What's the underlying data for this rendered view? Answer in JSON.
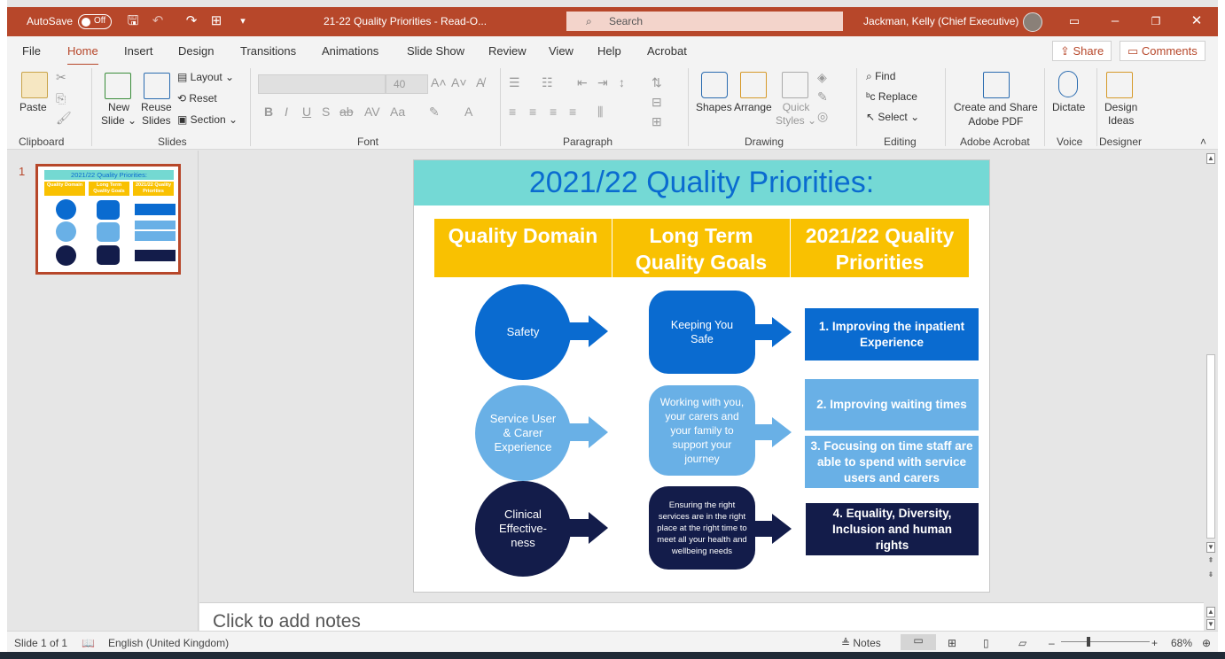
{
  "titlebar": {
    "autosave_label": "AutoSave",
    "autosave_state": "Off",
    "document_title": "21-22 Quality Priorities  -  Read-O...",
    "search_placeholder": "Search",
    "user": "Jackman, Kelly (Chief Executive)"
  },
  "tabs": [
    "File",
    "Home",
    "Insert",
    "Design",
    "Transitions",
    "Animations",
    "Slide Show",
    "Review",
    "View",
    "Help",
    "Acrobat"
  ],
  "share_label": "Share",
  "comments_label": "Comments",
  "ribbon": {
    "paste": "Paste",
    "new_slide": [
      "New",
      "Slide ⌄"
    ],
    "reuse_slides": [
      "Reuse",
      "Slides"
    ],
    "layout": "Layout ⌄",
    "reset": "Reset",
    "section": "Section ⌄",
    "font_size": "40",
    "shapes": "Shapes",
    "arrange": "Arrange",
    "quick_styles": [
      "Quick",
      "Styles ⌄"
    ],
    "find": "Find",
    "replace": "Replace",
    "select": "Select ⌄",
    "create_share_pdf": [
      "Create and Share",
      "Adobe PDF"
    ],
    "dictate": "Dictate",
    "design_ideas": [
      "Design",
      "Ideas"
    ],
    "groups": [
      "Clipboard",
      "Slides",
      "Font",
      "Paragraph",
      "Drawing",
      "Editing",
      "Adobe Acrobat",
      "Voice",
      "Designer"
    ]
  },
  "thumb_pane": {
    "slide_number": "1",
    "thumb_title": "2021/22 Quality Priorities:",
    "thumb_headers": [
      "Quality Domain",
      "Long Term Quality Goals",
      "2021/22 Quality Priorities"
    ]
  },
  "slide": {
    "title": "2021/22 Quality Priorities:",
    "headers": [
      "Quality Domain",
      "Long Term Quality Goals",
      "2021/22 Quality Priorities"
    ],
    "domains": [
      "Safety",
      "Service User & Carer Experience",
      "Clinical Effective-ness"
    ],
    "goals": [
      "Keeping You Safe",
      "Working with you, your carers and your family to support your journey",
      "Ensuring the right services are in the right place at the right time to meet all your health and wellbeing needs"
    ],
    "priorities": [
      "1. Improving the inpatient Experience",
      "2. Improving waiting times",
      "3. Focusing on time staff are able to spend with service users and carers",
      "4. Equality, Diversity, Inclusion and human rights"
    ],
    "colors": {
      "dark_blue": "#0a6bd0",
      "light_blue": "#69b0e6",
      "navy": "#131c4a",
      "gold": "#f9c101",
      "teal": "#74d9d5"
    }
  },
  "notes_placeholder": "Click to add notes",
  "status": {
    "slide_of": "Slide 1 of 1",
    "language": "English (United Kingdom)",
    "notes": "Notes",
    "zoom": "68%"
  }
}
